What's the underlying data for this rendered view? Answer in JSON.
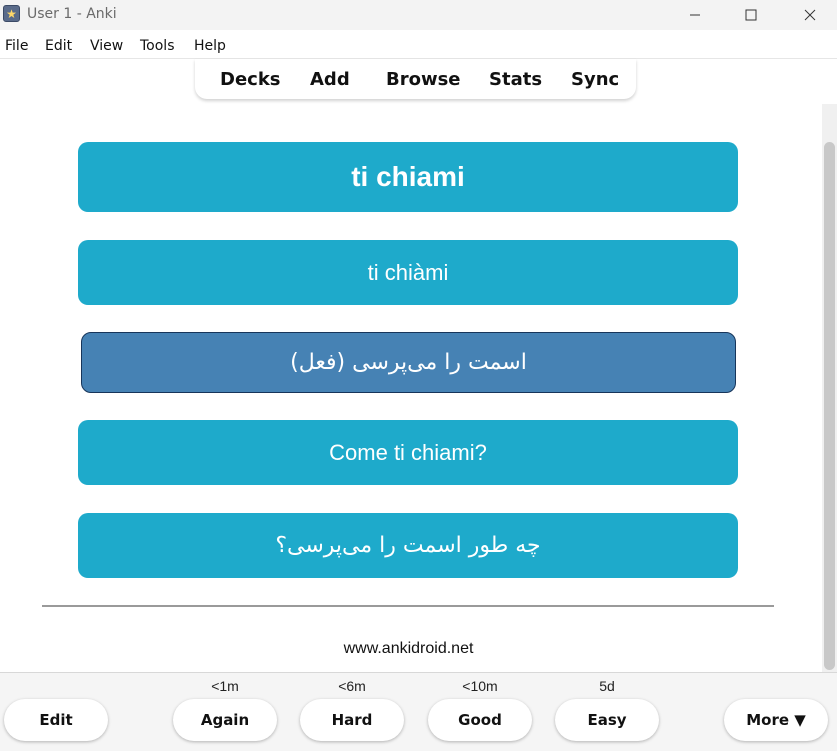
{
  "window": {
    "title": "User 1 - Anki",
    "app_icon": "anki-star-icon",
    "controls": [
      "minimize-icon",
      "maximize-icon",
      "close-icon"
    ]
  },
  "menu": {
    "file": "File",
    "edit": "Edit",
    "view": "View",
    "tools": "Tools",
    "help": "Help"
  },
  "toolbar": {
    "decks": "Decks",
    "add": "Add",
    "browse": "Browse",
    "stats": "Stats",
    "sync": "Sync"
  },
  "card": {
    "word": "ti chiami",
    "pronunciation": "ti chiàmi",
    "meaning": "اسمت را می‌پرسی (فعل)",
    "example": "Come ti chiami?",
    "example_translation": "چه طور اسمت را می‌پرسی؟",
    "footer_link": "www.ankidroid.net"
  },
  "answer_bar": {
    "edit": "Edit",
    "again": "Again",
    "again_interval": "<1m",
    "hard": "Hard",
    "hard_interval": "<6m",
    "good": "Good",
    "good_interval": "<10m",
    "easy": "Easy",
    "easy_interval": "5d",
    "more": "More ▼"
  },
  "colors": {
    "card_teal": "#1eaacb",
    "card_selected": "#4682b4",
    "text_on_card": "#ffffff"
  }
}
